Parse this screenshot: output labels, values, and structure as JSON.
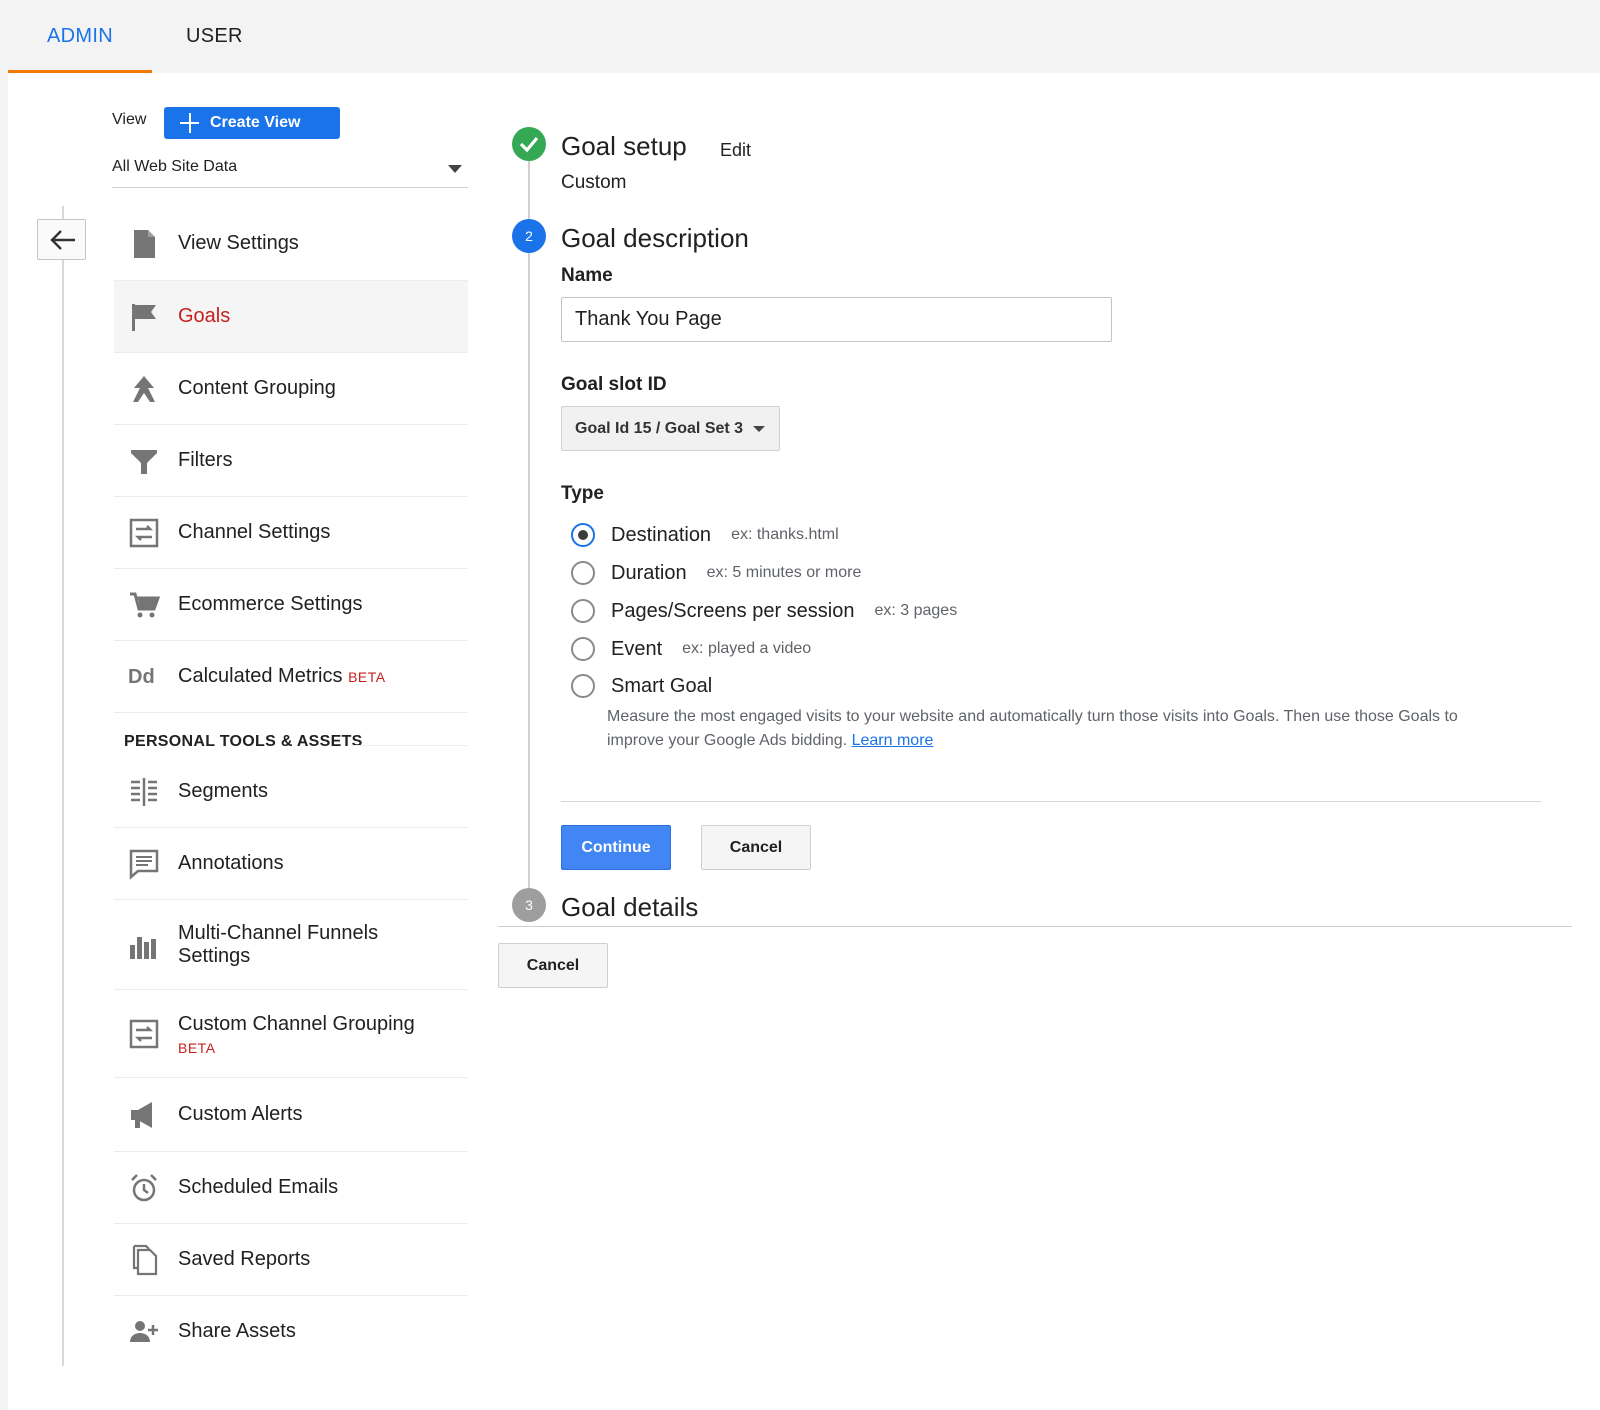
{
  "tabs": {
    "admin": "ADMIN",
    "user": "USER"
  },
  "view": {
    "label": "View",
    "create_button": "Create View",
    "selected": "All Web Site Data"
  },
  "nav": {
    "items": [
      {
        "label": "View Settings",
        "icon": "document-icon"
      },
      {
        "label": "Goals",
        "icon": "flag-icon",
        "active": true
      },
      {
        "label": "Content Grouping",
        "icon": "grouping-icon"
      },
      {
        "label": "Filters",
        "icon": "filter-icon"
      },
      {
        "label": "Channel Settings",
        "icon": "channel-settings-icon"
      },
      {
        "label": "Ecommerce Settings",
        "icon": "cart-icon"
      },
      {
        "label": "Calculated Metrics",
        "badge": "BETA",
        "icon": "dd-icon"
      }
    ],
    "section_title": "PERSONAL TOOLS & ASSETS",
    "personal_items": [
      {
        "label": "Segments",
        "icon": "segments-icon"
      },
      {
        "label": "Annotations",
        "icon": "annotation-icon"
      },
      {
        "label": "Multi-Channel Funnels Settings",
        "icon": "bar-chart-icon"
      },
      {
        "label": "Custom Channel Grouping",
        "badge": "BETA",
        "icon": "channel-grouping-icon"
      },
      {
        "label": "Custom Alerts",
        "icon": "megaphone-icon"
      },
      {
        "label": "Scheduled Emails",
        "icon": "alarm-icon"
      },
      {
        "label": "Saved Reports",
        "icon": "saved-report-icon"
      },
      {
        "label": "Share Assets",
        "icon": "add-person-icon"
      }
    ]
  },
  "steps": {
    "setup": {
      "title": "Goal setup",
      "edit": "Edit",
      "subtitle": "Custom"
    },
    "description": {
      "number": "2",
      "title": "Goal description"
    },
    "details": {
      "number": "3",
      "title": "Goal details"
    }
  },
  "form": {
    "name_label": "Name",
    "name_value": "Thank You Page",
    "slot_label": "Goal slot ID",
    "slot_value": "Goal Id 15 / Goal Set 3",
    "type_label": "Type",
    "types": [
      {
        "label": "Destination",
        "hint": "ex: thanks.html",
        "checked": true
      },
      {
        "label": "Duration",
        "hint": "ex: 5 minutes or more"
      },
      {
        "label": "Pages/Screens per session",
        "hint": "ex: 3 pages"
      },
      {
        "label": "Event",
        "hint": "ex: played a video"
      },
      {
        "label": "Smart Goal",
        "hint": ""
      }
    ],
    "smart_desc": "Measure the most engaged visits to your website and automatically turn those visits into Goals. Then use those Goals to improve your Google Ads bidding.",
    "learn_more": "Learn more",
    "continue_button": "Continue",
    "cancel_button": "Cancel"
  },
  "footer": {
    "cancel_button": "Cancel"
  },
  "colors": {
    "accent": "#1a73e8",
    "active_nav": "#c5221f",
    "tab_underline": "#f57c00",
    "success": "#34a853"
  }
}
